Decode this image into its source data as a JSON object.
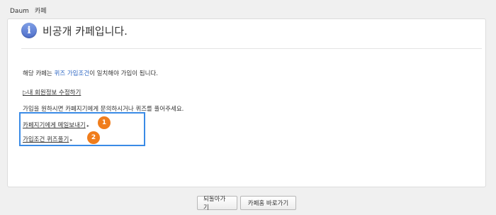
{
  "topbar": {
    "brand": "Daum",
    "service": "카페"
  },
  "notice": {
    "title": "비공개 카페입니다.",
    "icon": "info-icon"
  },
  "body": {
    "line1_prefix": "해당 카페는 ",
    "line1_link": "퀴즈 가입조건",
    "line1_suffix": "이 일치해야 가입이 됩니다.",
    "edit_info_link": "▷내 회원정보 수정하기",
    "line3": "가입을 원하시면 카페지기에게 문의하시거나 퀴즈를 풀어주세요.",
    "mail_link": "카페지기에게 메일보내기",
    "quiz_link": "가입조건 퀴즈풀기"
  },
  "annotations": {
    "badge1": "1",
    "badge2": "2",
    "highlight_color": "#3a8be6",
    "badge_color": "#f07d1c"
  },
  "buttons": {
    "back": "되돌아가기",
    "home": "카페홈 바로가기"
  }
}
